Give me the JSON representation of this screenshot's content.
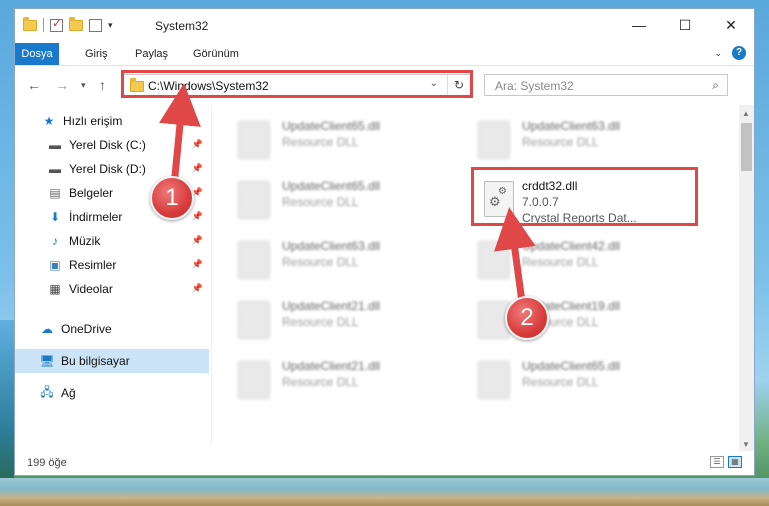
{
  "window": {
    "title": "System32",
    "controls": {
      "minimize": "—",
      "maximize": "☐",
      "close": "✕"
    }
  },
  "ribbon": {
    "tabs": [
      "Dosya",
      "Giriş",
      "Paylaş",
      "Görünüm"
    ]
  },
  "address_bar": {
    "path": "C:\\Windows\\System32"
  },
  "search": {
    "placeholder": "Ara: System32"
  },
  "sidebar": {
    "items": [
      {
        "label": "Hızlı erişim",
        "icon": "star-icon"
      },
      {
        "label": "Yerel Disk (C:)",
        "icon": "drive-icon",
        "pinned": true
      },
      {
        "label": "Yerel Disk (D:)",
        "icon": "drive-icon",
        "pinned": true
      },
      {
        "label": "Belgeler",
        "icon": "documents-icon",
        "pinned": true
      },
      {
        "label": "İndirmeler",
        "icon": "download-icon",
        "pinned": true
      },
      {
        "label": "Müzik",
        "icon": "music-icon",
        "pinned": true
      },
      {
        "label": "Resimler",
        "icon": "pictures-icon",
        "pinned": true
      },
      {
        "label": "Videolar",
        "icon": "video-icon",
        "pinned": true
      },
      {
        "label": "OneDrive",
        "icon": "cloud-icon"
      },
      {
        "label": "Bu bilgisayar",
        "icon": "computer-icon",
        "selected": true
      },
      {
        "label": "Ağ",
        "icon": "network-icon"
      }
    ]
  },
  "files": [
    {
      "name": "UpdateClient65.dll",
      "type": "Resource DLL"
    },
    {
      "name": "UpdateClient63.dll",
      "type": "Resource DLL"
    },
    {
      "name": "UpdateClient65.dll",
      "type": "Resource DLL"
    },
    {
      "name": "crddt32.dll",
      "version": "7.0.0.7",
      "description": "Crystal Reports Dat...",
      "highlighted": true
    },
    {
      "name": "UpdateClient63.dll",
      "type": "Resource DLL"
    },
    {
      "name": "UpdateClient42.dll",
      "type": "Resource DLL"
    },
    {
      "name": "UpdateClient21.dll",
      "type": "Resource DLL"
    },
    {
      "name": "UpdateClient19.dll",
      "type": "Resource DLL"
    },
    {
      "name": "UpdateClient21.dll",
      "type": "Resource DLL"
    },
    {
      "name": "UpdateClient65.dll",
      "type": "Resource DLL"
    }
  ],
  "status": {
    "count": "199 öğe"
  },
  "annotations": {
    "step1": "1",
    "step2": "2",
    "color": "#e04848"
  }
}
